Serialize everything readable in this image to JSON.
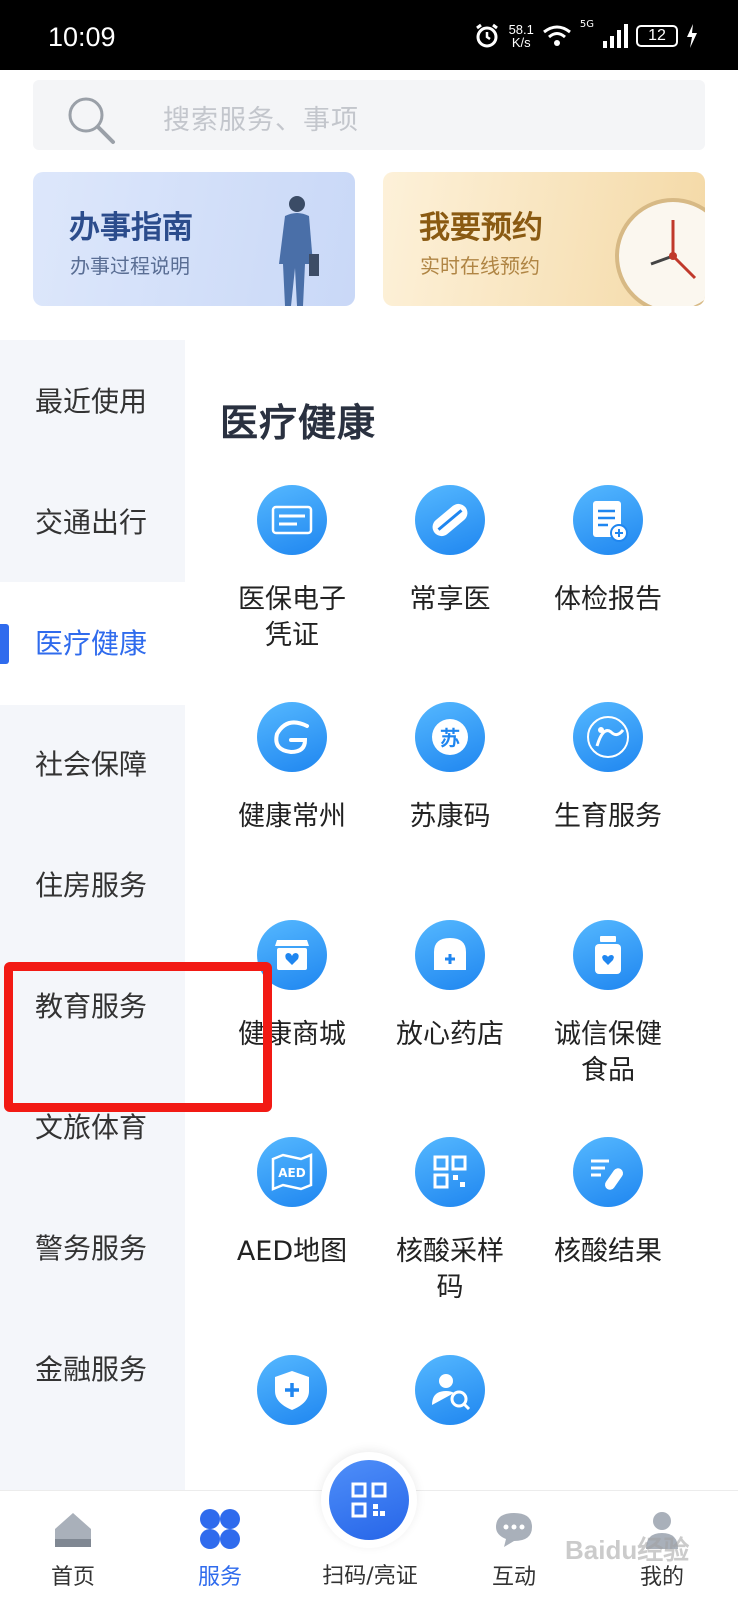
{
  "status_bar": {
    "time": "10:09",
    "net_speed_value": "58.1",
    "net_speed_unit": "K/s",
    "signal_label": "5G",
    "battery": "12"
  },
  "search": {
    "placeholder": "搜索服务、事项"
  },
  "banners": [
    {
      "title": "办事指南",
      "subtitle": "办事过程说明"
    },
    {
      "title": "我要预约",
      "subtitle": "实时在线预约"
    }
  ],
  "sidebar": {
    "items": [
      {
        "label": "最近使用"
      },
      {
        "label": "交通出行"
      },
      {
        "label": "医疗健康",
        "active": true
      },
      {
        "label": "社会保障"
      },
      {
        "label": "住房服务"
      },
      {
        "label": "教育服务"
      },
      {
        "label": "文旅体育"
      },
      {
        "label": "警务服务"
      },
      {
        "label": "金融服务"
      }
    ]
  },
  "content": {
    "section_title": "医疗健康",
    "services": [
      {
        "label": "医保电子凭证",
        "icon": "chs-card-icon"
      },
      {
        "label": "常享医",
        "icon": "pill-icon"
      },
      {
        "label": "体检报告",
        "icon": "report-icon"
      },
      {
        "label": "健康常州",
        "icon": "swirl-icon"
      },
      {
        "label": "苏康码",
        "icon": "su-code-icon"
      },
      {
        "label": "生育服务",
        "icon": "birth-icon"
      },
      {
        "label": "健康商城",
        "icon": "shop-icon"
      },
      {
        "label": "放心药店",
        "icon": "pharmacy-icon"
      },
      {
        "label": "诚信保健食品",
        "icon": "bottle-icon"
      },
      {
        "label": "AED地图",
        "icon": "aed-map-icon",
        "icon_text": "AED"
      },
      {
        "label": "核酸采样码",
        "icon": "qr-icon"
      },
      {
        "label": "核酸结果",
        "icon": "test-tube-icon"
      },
      {
        "label": "",
        "icon": "shield-plus-icon"
      },
      {
        "label": "",
        "icon": "user-search-icon"
      }
    ]
  },
  "tabbar": {
    "tabs": [
      {
        "label": "首页",
        "icon": "home-icon"
      },
      {
        "label": "服务",
        "icon": "grid-icon",
        "active": true
      },
      {
        "label": "扫码/亮证",
        "icon": "qr-scan-icon"
      },
      {
        "label": "互动",
        "icon": "chat-icon"
      },
      {
        "label": "我的",
        "icon": "person-icon"
      }
    ]
  },
  "watermark": "Baidu经验",
  "colors": {
    "accent": "#2f6bed",
    "highlight_box": "#f21a14",
    "icon_blue": "#1f86f0",
    "sidebar_bg": "#f4f6fa"
  }
}
